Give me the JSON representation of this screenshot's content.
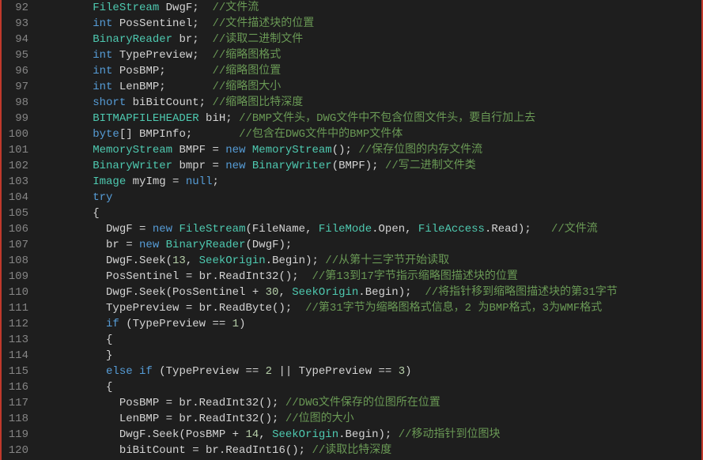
{
  "editor": {
    "startLine": 92,
    "endLine": 120,
    "lines": [
      {
        "indent": 3,
        "tokens": [
          "FileStream DwgF;  //文件流"
        ]
      },
      {
        "indent": 3,
        "tokens": [
          "int PosSentinel;  //文件描述块的位置"
        ]
      },
      {
        "indent": 3,
        "tokens": [
          "BinaryReader br;  //读取二进制文件"
        ]
      },
      {
        "indent": 3,
        "tokens": [
          "int TypePreview;  //缩略图格式"
        ]
      },
      {
        "indent": 3,
        "tokens": [
          "int PosBMP;       //缩略图位置"
        ]
      },
      {
        "indent": 3,
        "tokens": [
          "int LenBMP;       //缩略图大小"
        ]
      },
      {
        "indent": 3,
        "tokens": [
          "short biBitCount; //缩略图比特深度"
        ]
      },
      {
        "indent": 3,
        "tokens": [
          "BITMAPFILEHEADER biH; //BMP文件头，DWG文件中不包含位图文件头，要自行加上去"
        ]
      },
      {
        "indent": 3,
        "tokens": [
          "byte[] BMPInfo;       //包含在DWG文件中的BMP文件体"
        ]
      },
      {
        "indent": 3,
        "tokens": [
          "MemoryStream BMPF = new MemoryStream(); //保存位图的内存文件流"
        ]
      },
      {
        "indent": 3,
        "tokens": [
          "BinaryWriter bmpr = new BinaryWriter(BMPF); //写二进制文件类"
        ]
      },
      {
        "indent": 3,
        "tokens": [
          "Image myImg = null;"
        ]
      },
      {
        "indent": 3,
        "tokens": [
          "try"
        ]
      },
      {
        "indent": 3,
        "tokens": [
          "{"
        ]
      },
      {
        "indent": 4,
        "tokens": [
          "DwgF = new FileStream(FileName, FileMode.Open, FileAccess.Read);   //文件流"
        ]
      },
      {
        "indent": 4,
        "tokens": [
          "br = new BinaryReader(DwgF);"
        ]
      },
      {
        "indent": 4,
        "tokens": [
          "DwgF.Seek(13, SeekOrigin.Begin); //从第十三字节开始读取"
        ]
      },
      {
        "indent": 4,
        "tokens": [
          "PosSentinel = br.ReadInt32();  //第13到17字节指示缩略图描述块的位置"
        ]
      },
      {
        "indent": 4,
        "tokens": [
          "DwgF.Seek(PosSentinel + 30, SeekOrigin.Begin);  //将指针移到缩略图描述块的第31字节"
        ]
      },
      {
        "indent": 4,
        "tokens": [
          "TypePreview = br.ReadByte();  //第31字节为缩略图格式信息，2 为BMP格式，3为WMF格式"
        ]
      },
      {
        "indent": 4,
        "tokens": [
          "if (TypePreview == 1)"
        ]
      },
      {
        "indent": 4,
        "tokens": [
          "{"
        ]
      },
      {
        "indent": 4,
        "tokens": [
          "}"
        ]
      },
      {
        "indent": 4,
        "tokens": [
          "else if (TypePreview == 2 || TypePreview == 3)"
        ]
      },
      {
        "indent": 4,
        "tokens": [
          "{"
        ]
      },
      {
        "indent": 5,
        "tokens": [
          "PosBMP = br.ReadInt32(); //DWG文件保存的位图所在位置"
        ]
      },
      {
        "indent": 5,
        "tokens": [
          "LenBMP = br.ReadInt32(); //位图的大小"
        ]
      },
      {
        "indent": 5,
        "tokens": [
          "DwgF.Seek(PosBMP + 14, SeekOrigin.Begin); //移动指针到位图块"
        ]
      },
      {
        "indent": 5,
        "tokens": [
          "biBitCount = br.ReadInt16(); //读取比特深度"
        ]
      }
    ]
  }
}
